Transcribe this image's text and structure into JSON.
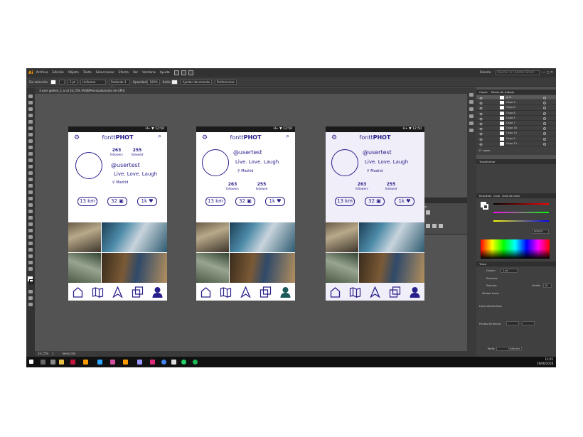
{
  "app": {
    "logo": "Ai",
    "menu": [
      "Archivo",
      "Edición",
      "Objeto",
      "Texto",
      "Seleccionar",
      "Efecto",
      "Ver",
      "Ventana",
      "Ayuda"
    ],
    "workspace": "Diseño",
    "search_placeholder": "Buscar en Adobe Stock"
  },
  "control_bar": {
    "mode": "Sin selección",
    "stroke": "1 pt",
    "uniform": "Uniforme",
    "brush": "Redondo 3 ...",
    "opacity_label": "Opacidad:",
    "opacity": "100%",
    "style_label": "Estilo:",
    "adjust_doc": "Ajustar documento",
    "prefs": "Preferencias"
  },
  "doc_tab": "3 user gallery_1.ai al 33,15% (RGB/Previsualización de GPU)",
  "status": {
    "zoom": "33,15%",
    "page": "1",
    "tool": "Selección"
  },
  "layers": {
    "tabs": [
      "Capas",
      "Mesas de trabajo"
    ],
    "items": [
      "grill",
      "Capa 4",
      "Capa 8",
      "Capa 8",
      "Capa 5",
      "Capa 7",
      "Capa 16",
      "Capa 14",
      "Capa 9",
      "Capa 13"
    ],
    "count": "12 capas"
  },
  "panels": {
    "transform": "Transformar",
    "color_tabs": [
      "Muestras",
      "Color",
      "Guía de color"
    ],
    "hex": "FFFFFF",
    "stroke": "Trazo",
    "grosor_label": "Grosor:",
    "grosor": "1 pt",
    "extremo": "Extremo:",
    "esquina": "Esquina:",
    "limite": "Límite:",
    "limite_val": "10",
    "alinear": "Alinear trazo:",
    "discontinua": "Línea discontinua",
    "perfil_label": "Perfil:",
    "perfil": "Uniforme",
    "puntas": "Puntas de flecha:"
  },
  "float_panel": {
    "title": "Buscatrazos",
    "modos": "Modos de forma:",
    "expandir": "Expandir",
    "buscatrazos": "Buscatrazos:"
  },
  "taskbar": {
    "time": "12:05",
    "date": "19/06/2018"
  },
  "phone": {
    "status": "H+ ▼ 12:50",
    "brand_light": "fontt",
    "brand_bold": "PHOT",
    "user": "@usertest",
    "tagline": "Live. Love. Laugh",
    "location": "Madrid",
    "followers": "263",
    "followers_label": "followers",
    "followed": "255",
    "followed_label": "followed",
    "km": "13 km",
    "photos": "32",
    "likes": "1k"
  },
  "colors": {
    "accent": "#28208a",
    "adobe": "#ff9a00"
  }
}
